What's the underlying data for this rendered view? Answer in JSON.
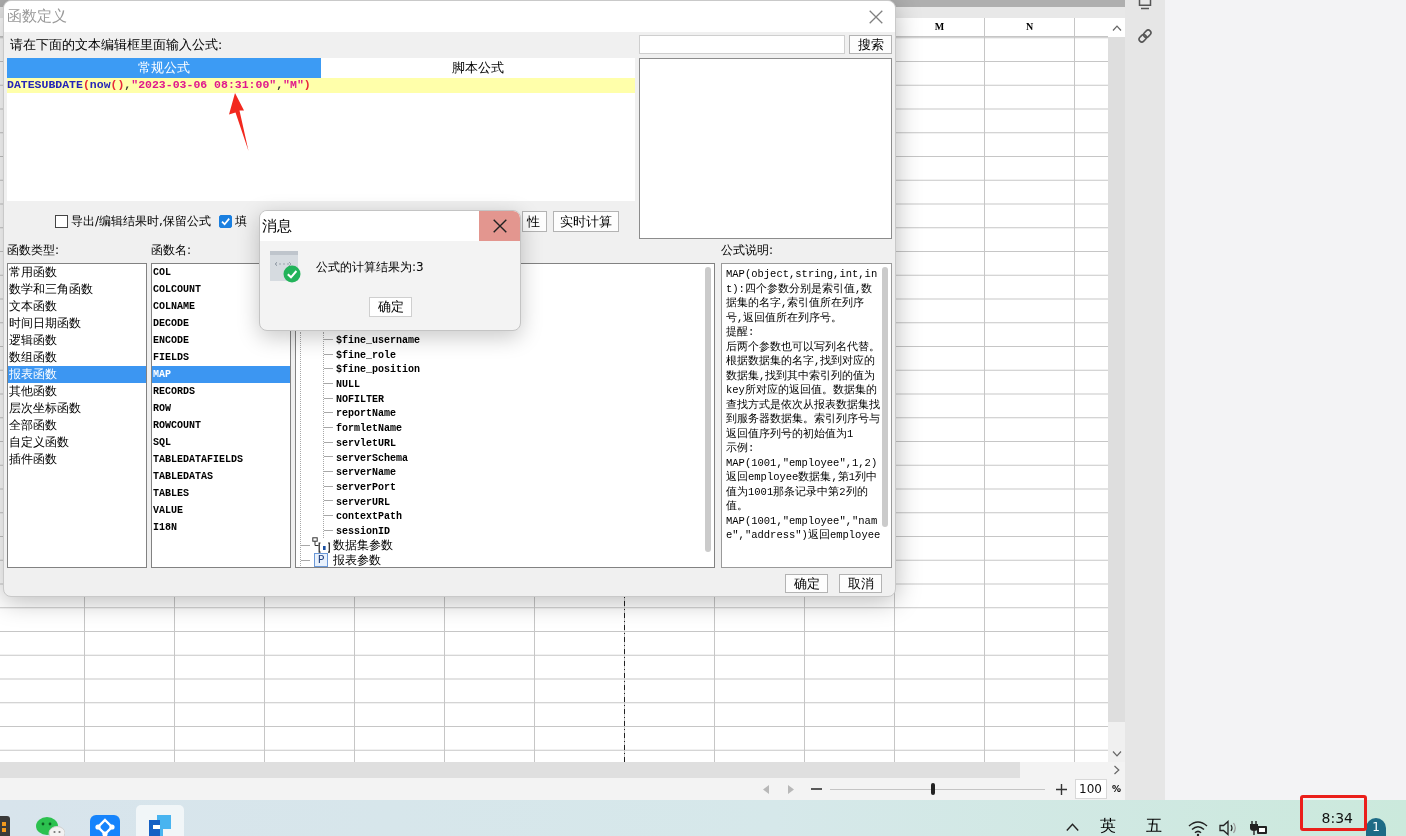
{
  "dialog": {
    "title": "函数定义",
    "active": false,
    "prompt": "请在下面的文本编辑框里面输入公式:",
    "editor_tabs": [
      {
        "label": "常规公式",
        "selected": true
      },
      {
        "label": "脚本公式",
        "selected": false
      }
    ],
    "editor_lines": [
      {
        "highlighted": true,
        "tokens": [
          {
            "text": "DATESUBDATE",
            "kind": "function"
          },
          {
            "text": "(",
            "kind": "paren"
          },
          {
            "text": "now",
            "kind": "function"
          },
          {
            "text": "()",
            "kind": "paren"
          },
          {
            "text": ",",
            "kind": "plain"
          },
          {
            "text": "\"2023-03-06 08:31:00\"",
            "kind": "string"
          },
          {
            "text": ",",
            "kind": "plain"
          },
          {
            "text": "\"M\"",
            "kind": "string"
          },
          {
            "text": ")",
            "kind": "paren"
          }
        ]
      }
    ],
    "options": [
      {
        "label": "导出/编辑结果时,保留公式",
        "checked": false
      },
      {
        "label": "填",
        "checked": true
      }
    ],
    "editor_buttons": [
      "性",
      "实时计算"
    ],
    "search": {
      "button": "搜索"
    },
    "function_types": {
      "label": "函数类型:",
      "items": [
        {
          "label": "常用函数",
          "selected": false
        },
        {
          "label": "数学和三角函数",
          "selected": false
        },
        {
          "label": "文本函数",
          "selected": false
        },
        {
          "label": "时间日期函数",
          "selected": false
        },
        {
          "label": "逻辑函数",
          "selected": false
        },
        {
          "label": "数组函数",
          "selected": false
        },
        {
          "label": "报表函数",
          "selected": true
        },
        {
          "label": "其他函数",
          "selected": false
        },
        {
          "label": "层次坐标函数",
          "selected": false
        },
        {
          "label": "全部函数",
          "selected": false
        },
        {
          "label": "自定义函数",
          "selected": false
        },
        {
          "label": "插件函数",
          "selected": false
        }
      ]
    },
    "function_names": {
      "label": "函数名:",
      "items": [
        {
          "label": "COL",
          "selected": false
        },
        {
          "label": "COLCOUNT",
          "selected": false
        },
        {
          "label": "COLNAME",
          "selected": false
        },
        {
          "label": "DECODE",
          "selected": false
        },
        {
          "label": "ENCODE",
          "selected": false
        },
        {
          "label": "FIELDS",
          "selected": false
        },
        {
          "label": "MAP",
          "selected": true
        },
        {
          "label": "RECORDS",
          "selected": false
        },
        {
          "label": "ROW",
          "selected": false
        },
        {
          "label": "ROWCOUNT",
          "selected": false
        },
        {
          "label": "SQL",
          "selected": false
        },
        {
          "label": "TABLEDATAFIELDS",
          "selected": false
        },
        {
          "label": "TABLEDATAS",
          "selected": false
        },
        {
          "label": "TABLES",
          "selected": false
        },
        {
          "label": "VALUE",
          "selected": false
        },
        {
          "label": "I18N",
          "selected": false
        }
      ]
    },
    "parameters": {
      "items": [
        {
          "kind": "group",
          "children": [
            {
              "label": "$fine_username"
            },
            {
              "label": "$fine_role"
            },
            {
              "label": "$fine_position"
            },
            {
              "label": "NULL"
            },
            {
              "label": "NOFILTER"
            },
            {
              "label": "reportName"
            },
            {
              "label": "formletName"
            },
            {
              "label": "servletURL"
            },
            {
              "label": "serverSchema"
            },
            {
              "label": "serverName"
            },
            {
              "label": "serverPort"
            },
            {
              "label": "serverURL"
            },
            {
              "label": "contextPath"
            },
            {
              "label": "sessionID"
            }
          ]
        },
        {
          "kind": "dataset",
          "label": "数据集参数"
        },
        {
          "kind": "report",
          "badge": "P",
          "label": "报表参数"
        }
      ]
    },
    "description": {
      "label": "公式说明:",
      "paragraphs": [
        "MAP(object,string,int,int):四个参数分别是索引值,数据集的名字,索引值所在列序号,返回值所在列序号。",
        "提醒:",
        "后两个参数也可以写列名代替。根据数据集的名字,找到对应的数据集,找到其中索引列的值为key所对应的返回值。数据集的查找方式是依次从报表数据集找到服务器数据集。索引列序号与返回值序列号的初始值为1",
        "示例:",
        "MAP(1001,\"employee\",1,2)返回employee数据集,第1列中值为1001那条记录中第2列的值。",
        "MAP(1001,\"employee\",\"name\",\"address\")返回employee"
      ]
    },
    "buttons": [
      "确定",
      "取消"
    ]
  },
  "message": {
    "title": "消息",
    "text": "公式的计算结果为:3",
    "button": "确定"
  },
  "sheet": {
    "columns": [
      "M",
      "N"
    ],
    "zoom": {
      "level": 0.48,
      "value": "100",
      "unit": "%"
    }
  },
  "taskbar": {
    "apps": [
      {
        "kind": "tiles",
        "selected": false
      },
      {
        "kind": "chat",
        "selected": false
      },
      {
        "kind": "nodes",
        "selected": false
      },
      {
        "kind": "document",
        "selected": true
      }
    ],
    "input_language": "英",
    "input_mode": "五",
    "time": "8:34",
    "notification_count": "1"
  }
}
